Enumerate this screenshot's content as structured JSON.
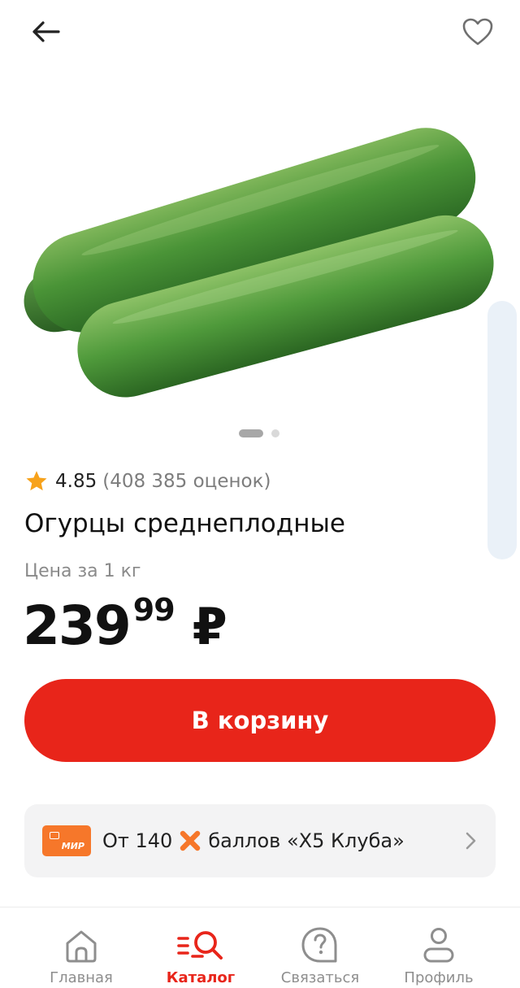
{
  "product": {
    "rating": "4.85",
    "rating_count": "(408 385 оценок)",
    "title": "Огурцы среднеплодные",
    "price_label": "Цена за 1 кг",
    "price_rub": "239",
    "price_kop": "99",
    "currency": "₽",
    "images_total": 2,
    "image_active": 1
  },
  "cart_button": {
    "label": "В корзину"
  },
  "bonus": {
    "card_brand": "МИР",
    "text_before": "От 140",
    "text_after": "баллов «Х5 Клуба»"
  },
  "bottom_nav": {
    "items": [
      {
        "label": "Главная",
        "icon": "home-icon"
      },
      {
        "label": "Каталог",
        "icon": "catalog-search-icon",
        "active": true
      },
      {
        "label": "Связаться",
        "icon": "help-chat-icon"
      },
      {
        "label": "Профиль",
        "icon": "profile-icon"
      }
    ]
  },
  "colors": {
    "accent": "#e8251a",
    "mir_orange": "#f6772a",
    "card_bg": "#f3f3f4",
    "star": "#f7a21b"
  },
  "icons": {
    "back": "arrow-left-icon",
    "favorite": "heart-outline-icon",
    "rating": "star-icon",
    "more": "chevron-right-icon"
  }
}
